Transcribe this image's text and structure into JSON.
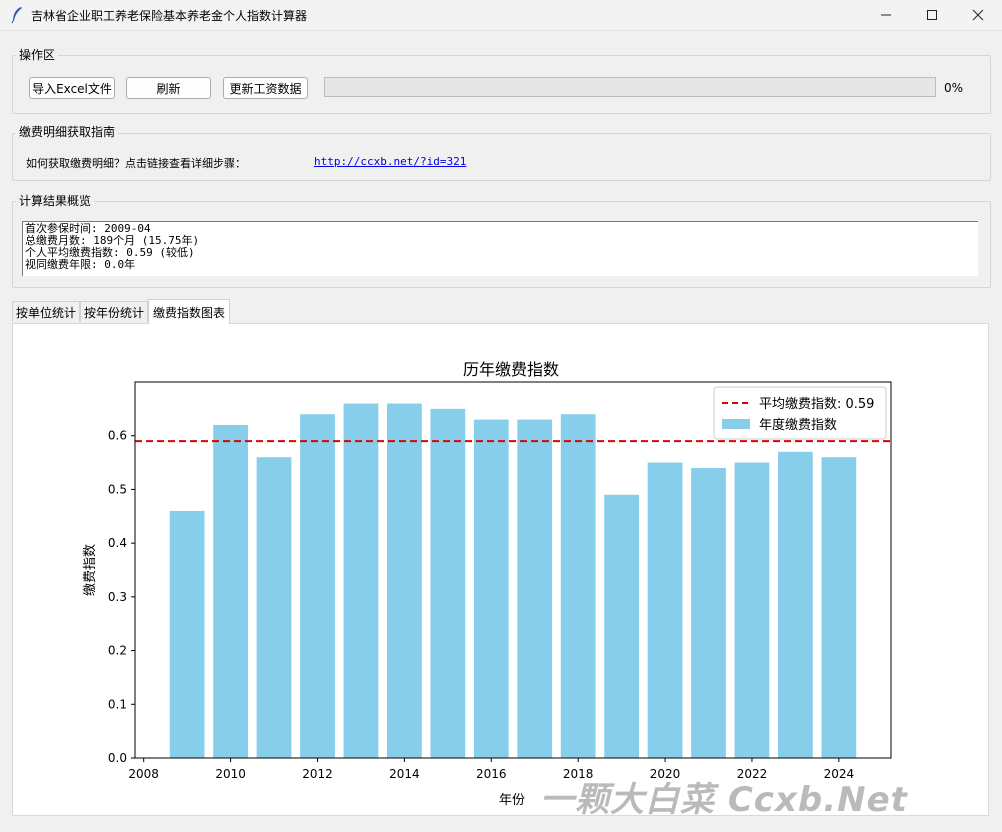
{
  "window": {
    "title": "吉林省企业职工养老保险基本养老金个人指数计算器",
    "controls": {
      "minimize": "minimize-icon",
      "maximize": "maximize-icon",
      "close": "close-icon"
    }
  },
  "operations": {
    "label": "操作区",
    "import_label": "导入Excel文件",
    "refresh_label": "刷新",
    "update_label": "更新工资数据",
    "progress_value": 0,
    "progress_text": "0%"
  },
  "guide": {
    "label": "缴费明细获取指南",
    "text": "如何获取缴费明细？点击链接查看详细步骤：",
    "link": "http://ccxb.net/?id=321"
  },
  "summary": {
    "label": "计算结果概览",
    "lines": [
      "首次参保时间: 2009-04",
      "总缴费月数: 189个月 (15.75年)",
      "个人平均缴费指数: 0.59 (较低)",
      "视同缴费年限: 0.0年"
    ]
  },
  "tabs": [
    "按单位统计",
    "按年份统计",
    "缴费指数图表"
  ],
  "active_tab": 2,
  "chart_data": {
    "type": "bar",
    "title": "历年缴费指数",
    "xlabel": "年份",
    "ylabel": "缴费指数",
    "x": [
      2009,
      2010,
      2011,
      2012,
      2013,
      2014,
      2015,
      2016,
      2017,
      2018,
      2019,
      2020,
      2021,
      2022,
      2023,
      2024
    ],
    "series": [
      {
        "name": "年度缴费指数",
        "values": [
          0.46,
          0.62,
          0.56,
          0.64,
          0.66,
          0.66,
          0.65,
          0.63,
          0.63,
          0.64,
          0.49,
          0.55,
          0.54,
          0.55,
          0.57,
          0.56
        ],
        "color": "#87ceeb"
      }
    ],
    "average": {
      "name": "平均缴费指数: 0.59",
      "value": 0.59,
      "color": "#e00000",
      "style": "dashed"
    },
    "xlim": [
      2007.8,
      2025.2
    ],
    "ylim": [
      0,
      0.7
    ],
    "xticks": [
      2008,
      2010,
      2012,
      2014,
      2016,
      2018,
      2020,
      2022,
      2024
    ],
    "yticks": [
      0.0,
      0.1,
      0.2,
      0.3,
      0.4,
      0.5,
      0.6
    ],
    "legend_position": "top-right",
    "grid": false
  },
  "watermark": "一颗大白菜 Ccxb.Net"
}
